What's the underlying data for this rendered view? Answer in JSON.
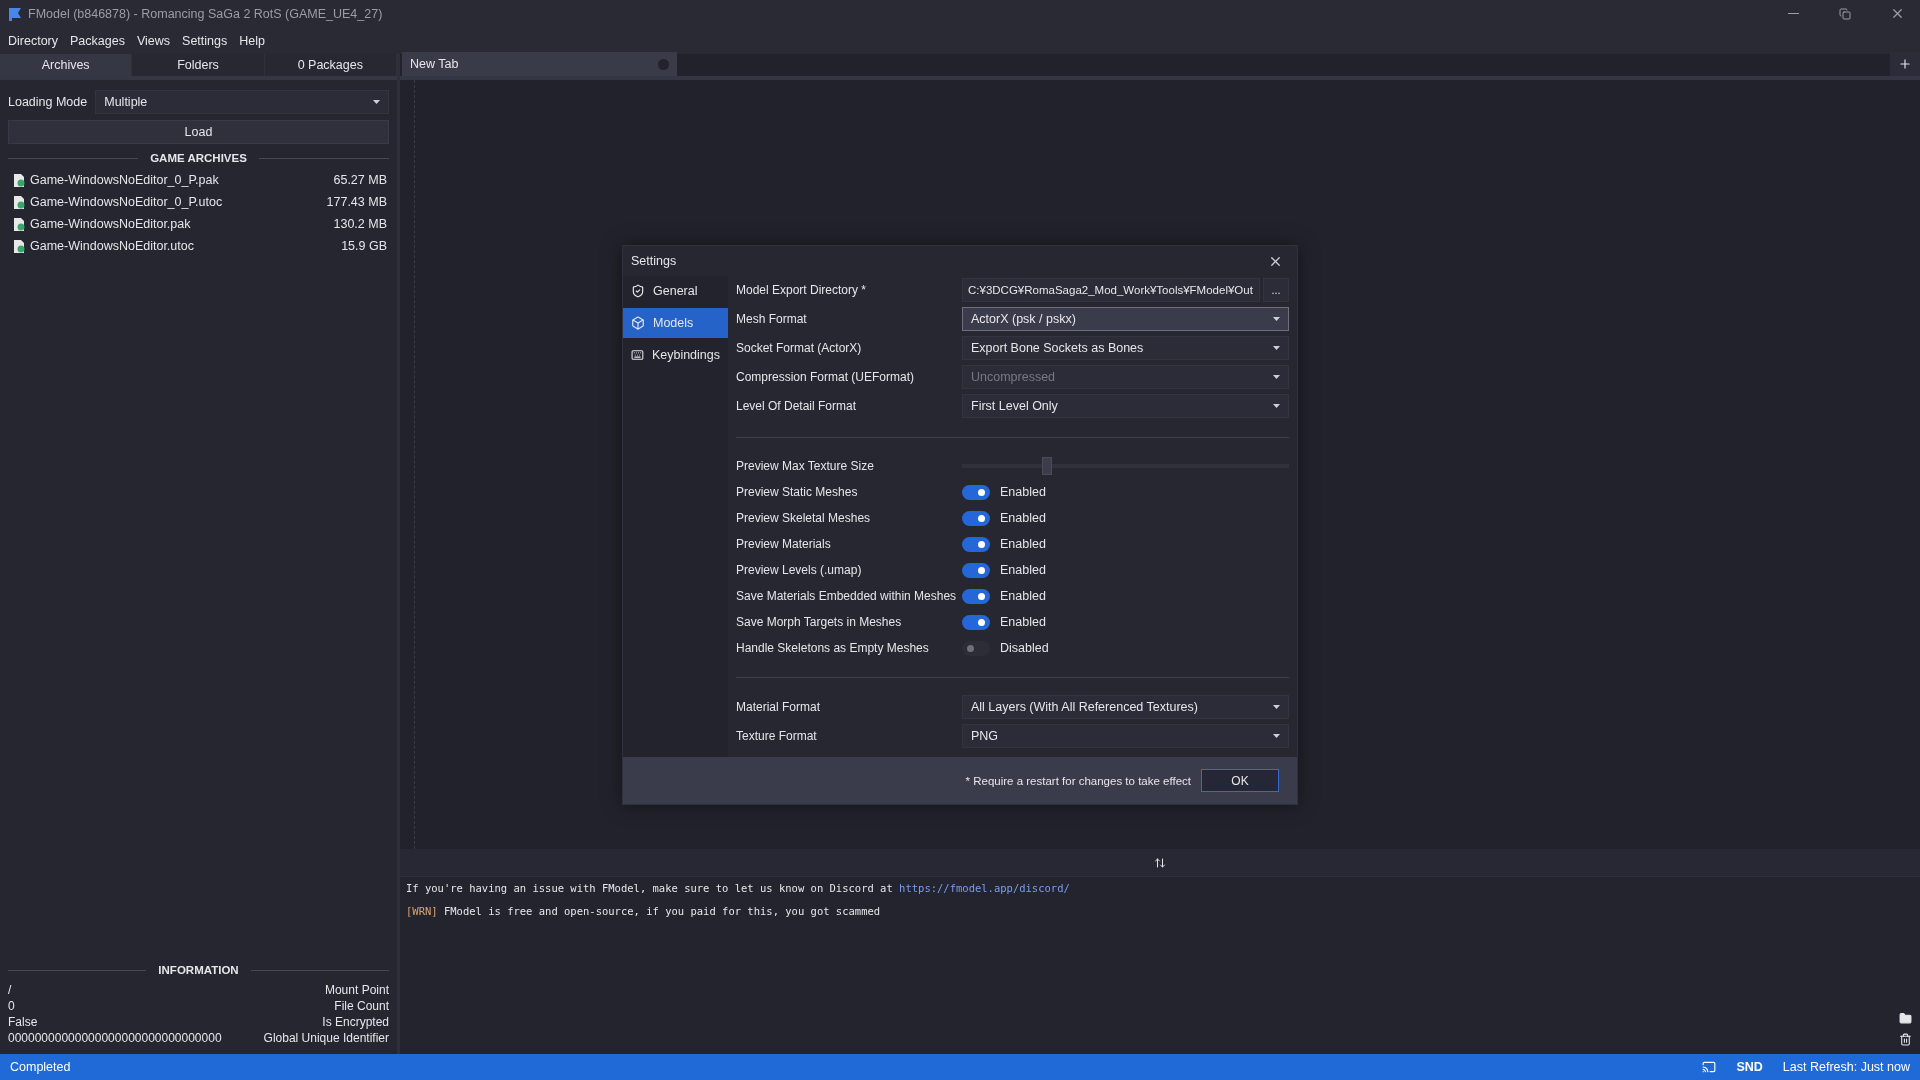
{
  "window": {
    "title": "FModel (b846878) - Romancing SaGa 2 RotS (GAME_UE4_27)"
  },
  "menu": [
    "Directory",
    "Packages",
    "Views",
    "Settings",
    "Help"
  ],
  "left_panel": {
    "tabs": [
      {
        "label": "Archives",
        "selected": true
      },
      {
        "label": "Folders",
        "selected": false
      },
      {
        "label": "0 Packages",
        "selected": false
      }
    ],
    "loading_mode": {
      "label": "Loading Mode",
      "value": "Multiple"
    },
    "load_button": "Load",
    "archives_heading": "GAME ARCHIVES",
    "archives": [
      {
        "name": "Game-WindowsNoEditor_0_P.pak",
        "size": "65.27 MB"
      },
      {
        "name": "Game-WindowsNoEditor_0_P.utoc",
        "size": "177.43 MB"
      },
      {
        "name": "Game-WindowsNoEditor.pak",
        "size": "130.2 MB"
      },
      {
        "name": "Game-WindowsNoEditor.utoc",
        "size": "15.9 GB"
      }
    ],
    "information_heading": "INFORMATION",
    "information": [
      {
        "value": "/",
        "label": "Mount Point"
      },
      {
        "value": "0",
        "label": "File Count"
      },
      {
        "value": "False",
        "label": "Is Encrypted"
      },
      {
        "value": "00000000000000000000000000000000",
        "label": "Global Unique Identifier"
      }
    ]
  },
  "document_tabs": [
    {
      "label": "New Tab",
      "selected": true
    }
  ],
  "console": [
    {
      "kind": "info",
      "text": "If you're having an issue with FModel, make sure to let us know on Discord at",
      "link": "https://fmodel.app/discord/"
    },
    {
      "kind": "warn",
      "tag": "[WRN]",
      "text": "FModel is free and open-source, if you paid for this, you got scammed"
    }
  ],
  "settings": {
    "title": "Settings",
    "nav": [
      {
        "label": "General",
        "selected": false
      },
      {
        "label": "Models",
        "selected": true
      },
      {
        "label": "Keybindings",
        "selected": false
      }
    ],
    "sections": [
      [
        {
          "kind": "path",
          "label": "Model Export Directory *",
          "value": "C:¥3DCG¥RomaSaga2_Mod_Work¥Tools¥FModel¥Out",
          "button": "..."
        },
        {
          "kind": "select",
          "label": "Mesh Format",
          "value": "ActorX (psk / pskx)",
          "focused": true,
          "disabled": false
        },
        {
          "kind": "select",
          "label": "Socket Format (ActorX)",
          "value": "Export Bone Sockets as Bones",
          "focused": false,
          "disabled": false
        },
        {
          "kind": "select",
          "label": "Compression Format (UEFormat)",
          "value": "Uncompressed",
          "focused": false,
          "disabled": true
        },
        {
          "kind": "select",
          "label": "Level Of Detail Format",
          "value": "First Level Only",
          "focused": false,
          "disabled": false
        }
      ],
      [
        {
          "kind": "slider",
          "label": "Preview Max Texture Size",
          "level": 0.26
        },
        {
          "kind": "toggle",
          "label": "Preview Static Meshes",
          "on": true,
          "state_text": "Enabled"
        },
        {
          "kind": "toggle",
          "label": "Preview Skeletal Meshes",
          "on": true,
          "state_text": "Enabled"
        },
        {
          "kind": "toggle",
          "label": "Preview Materials",
          "on": true,
          "state_text": "Enabled"
        },
        {
          "kind": "toggle",
          "label": "Preview Levels (.umap)",
          "on": true,
          "state_text": "Enabled"
        },
        {
          "kind": "toggle",
          "label": "Save Materials Embedded within Meshes",
          "on": true,
          "state_text": "Enabled"
        },
        {
          "kind": "toggle",
          "label": "Save Morph Targets in Meshes",
          "on": true,
          "state_text": "Enabled"
        },
        {
          "kind": "toggle",
          "label": "Handle Skeletons as Empty Meshes",
          "on": false,
          "state_text": "Disabled"
        }
      ],
      [
        {
          "kind": "select",
          "label": "Material Format",
          "value": "All Layers (With All Referenced Textures)",
          "focused": false,
          "disabled": false
        },
        {
          "kind": "select",
          "label": "Texture Format",
          "value": "PNG",
          "focused": false,
          "disabled": false
        }
      ]
    ],
    "note": "* Require a restart for changes to take effect",
    "ok_button": "OK"
  },
  "status_bar": {
    "status": "Completed",
    "items": [
      "SND",
      "Last Refresh: Just now"
    ]
  }
}
